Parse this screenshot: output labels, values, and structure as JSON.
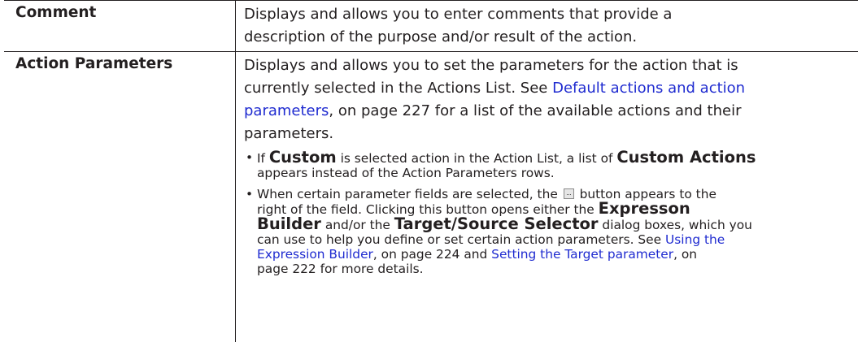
{
  "table": {
    "rows": [
      {
        "term": "Comment",
        "desc_lines": [
          "Displays and allows you to enter comments that provide a",
          "description of the purpose and/or result of the action."
        ]
      },
      {
        "term": "Action Parameters",
        "desc_line1": "Displays and allows you to set the parameters for the action that is",
        "desc_line2_pre": "currently selected in the Actions List. See ",
        "desc_link_a": "Default actions and action",
        "desc_link_b": "parameters",
        "desc_line3_post": ", on page 227 for a list of the available actions and their",
        "desc_line4": "parameters.",
        "bullets": {
          "b1_pre": "If ",
          "b1_custom": "Custom",
          "b1_mid": " is selected action in the Action List, a list of ",
          "b1_custom_actions": "Custom Actions",
          "b1_line2": "appears instead of the Action Parameters rows.",
          "b2_pre": "When certain parameter fields are selected, the ",
          "b2_post": " button appears to the",
          "b2_line2": "right of the field. Clicking this button opens either the ",
          "b2_expression": "Expresson",
          "b2_builder": "Builder",
          "b2_line3_mid": " and/or the ",
          "b2_target": "Target/Source Selector",
          "b2_line3_post": " dialog boxes, which you",
          "b2_line4": "can use to help you define or set certain action parameters. See ",
          "b2_link_using": "Using the",
          "b2_link_expr": "Expression Builder",
          "b2_line5_mid": ", on page 224 and ",
          "b2_link_setting": "Setting the Target parameter",
          "b2_line5_post": ", on",
          "b2_line6": "page 222 for more details."
        }
      }
    ]
  },
  "colors": {
    "text": "#231f20",
    "link": "#1f2bd0",
    "rule": "#231f20"
  },
  "icons": {
    "ellipsis_button": "ellipsis-button-icon"
  }
}
